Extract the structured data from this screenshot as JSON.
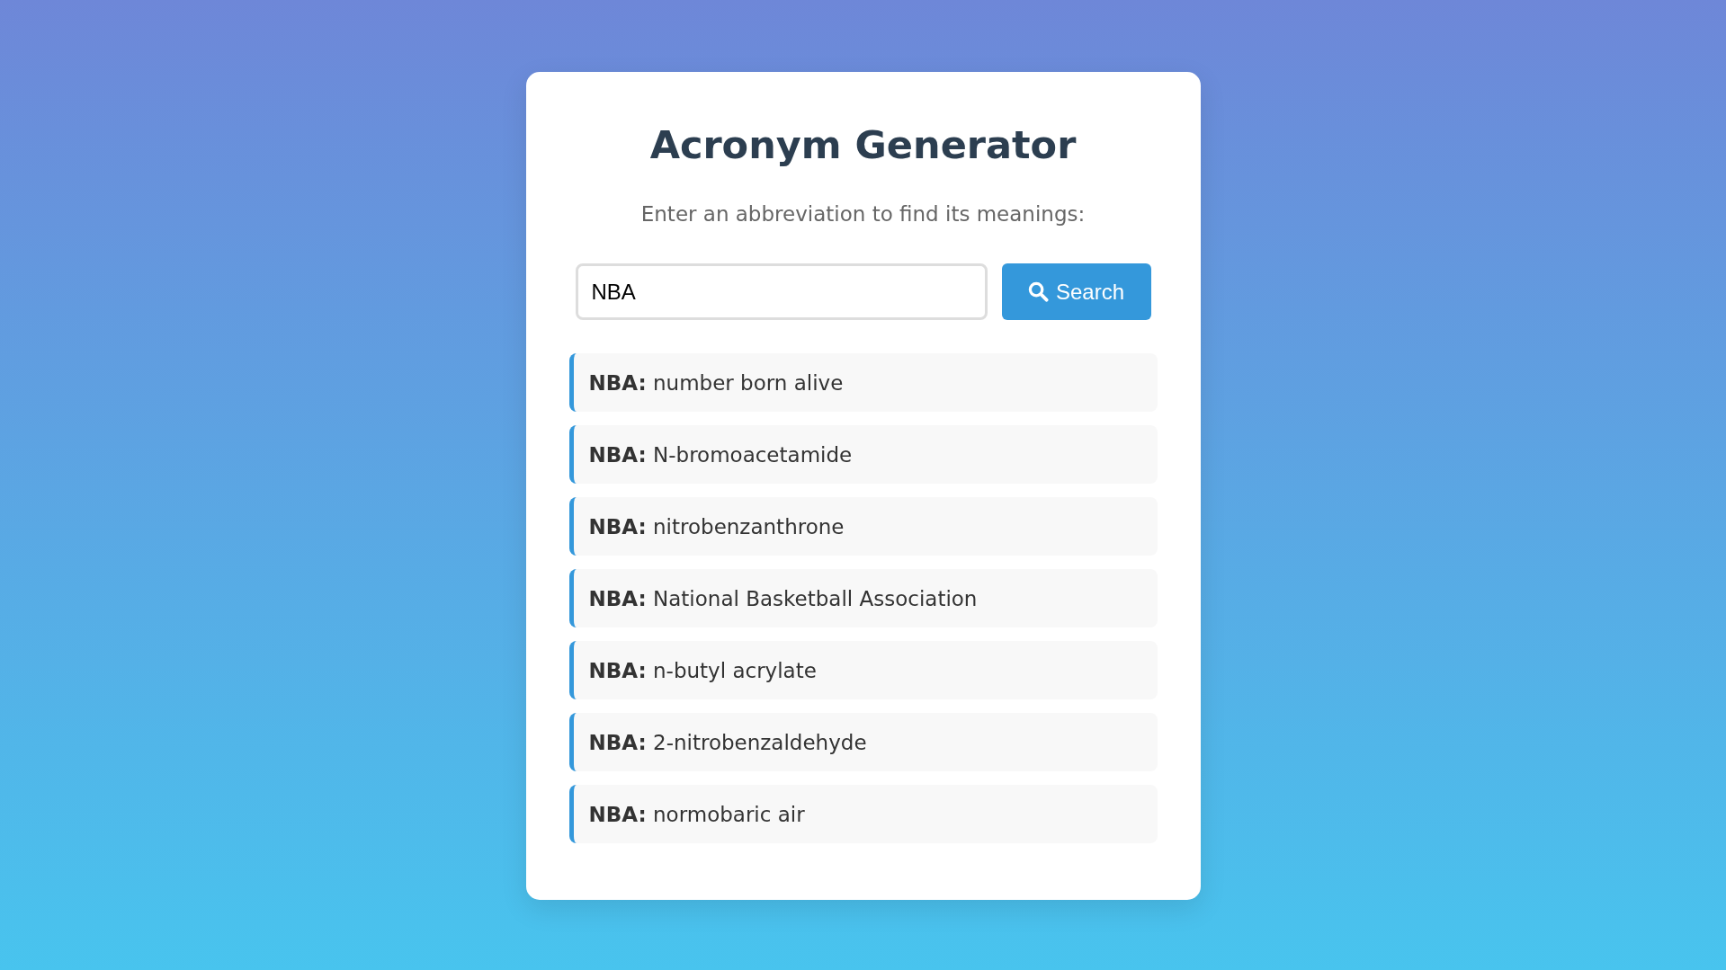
{
  "title": "Acronym Generator",
  "subtitle": "Enter an abbreviation to find its meanings:",
  "search": {
    "value": "NBA"
  },
  "search_button": {
    "label": "Search"
  },
  "results": [
    {
      "text": "**NBA:** number born alive"
    },
    {
      "text": "**NBA:** N-bromoacetamide"
    },
    {
      "text": "**NBA:** nitrobenzanthrone"
    },
    {
      "text": "**NBA:** National Basketball Association"
    },
    {
      "text": "**NBA:** n-butyl acrylate"
    },
    {
      "text": "**NBA:** 2-nitrobenzaldehyde"
    },
    {
      "text": "**NBA:** normobaric air"
    }
  ]
}
